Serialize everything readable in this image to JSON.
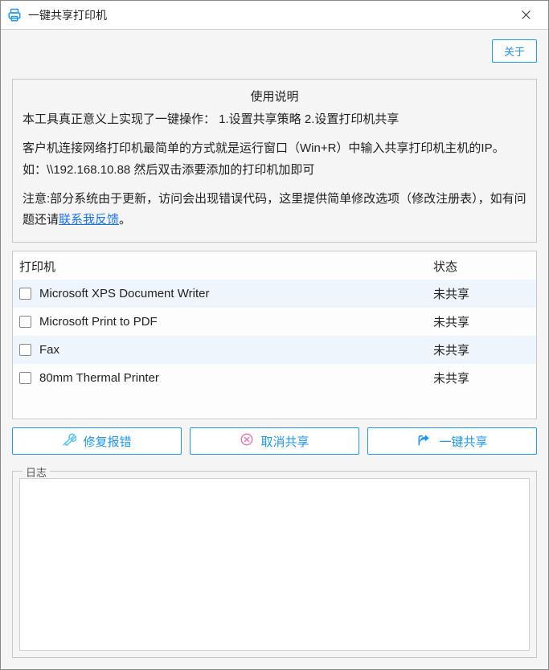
{
  "window": {
    "title": "一键共享打印机"
  },
  "header": {
    "about_label": "关于"
  },
  "instructions": {
    "title": "使用说明",
    "line1": "本工具真正意义上实现了一键操作：   1.设置共享策略 2.设置打印机共享",
    "line2": "客户机连接网络打印机最简单的方式就是运行窗口（Win+R）中输入共享打印机主机的IP。如：\\\\192.168.10.88 然后双击添要添加的打印机加即可",
    "line3_prefix": "注意:部分系统由于更新，访问会出现错误代码，这里提供简单修改选项（修改注册表），如有问题还请",
    "line3_link": "联系我反馈",
    "line3_suffix": "。"
  },
  "printerTable": {
    "col_name": "打印机",
    "col_status": "状态",
    "rows": [
      {
        "name": "Microsoft XPS Document Writer",
        "status": "未共享"
      },
      {
        "name": "Microsoft Print to PDF",
        "status": "未共享"
      },
      {
        "name": "Fax",
        "status": "未共享"
      },
      {
        "name": "80mm Thermal Printer",
        "status": "未共享"
      }
    ]
  },
  "actions": {
    "repair": "修复报错",
    "unshare": "取消共享",
    "share": "一键共享"
  },
  "log": {
    "label": "日志"
  },
  "colors": {
    "accent": "#2196f3"
  }
}
